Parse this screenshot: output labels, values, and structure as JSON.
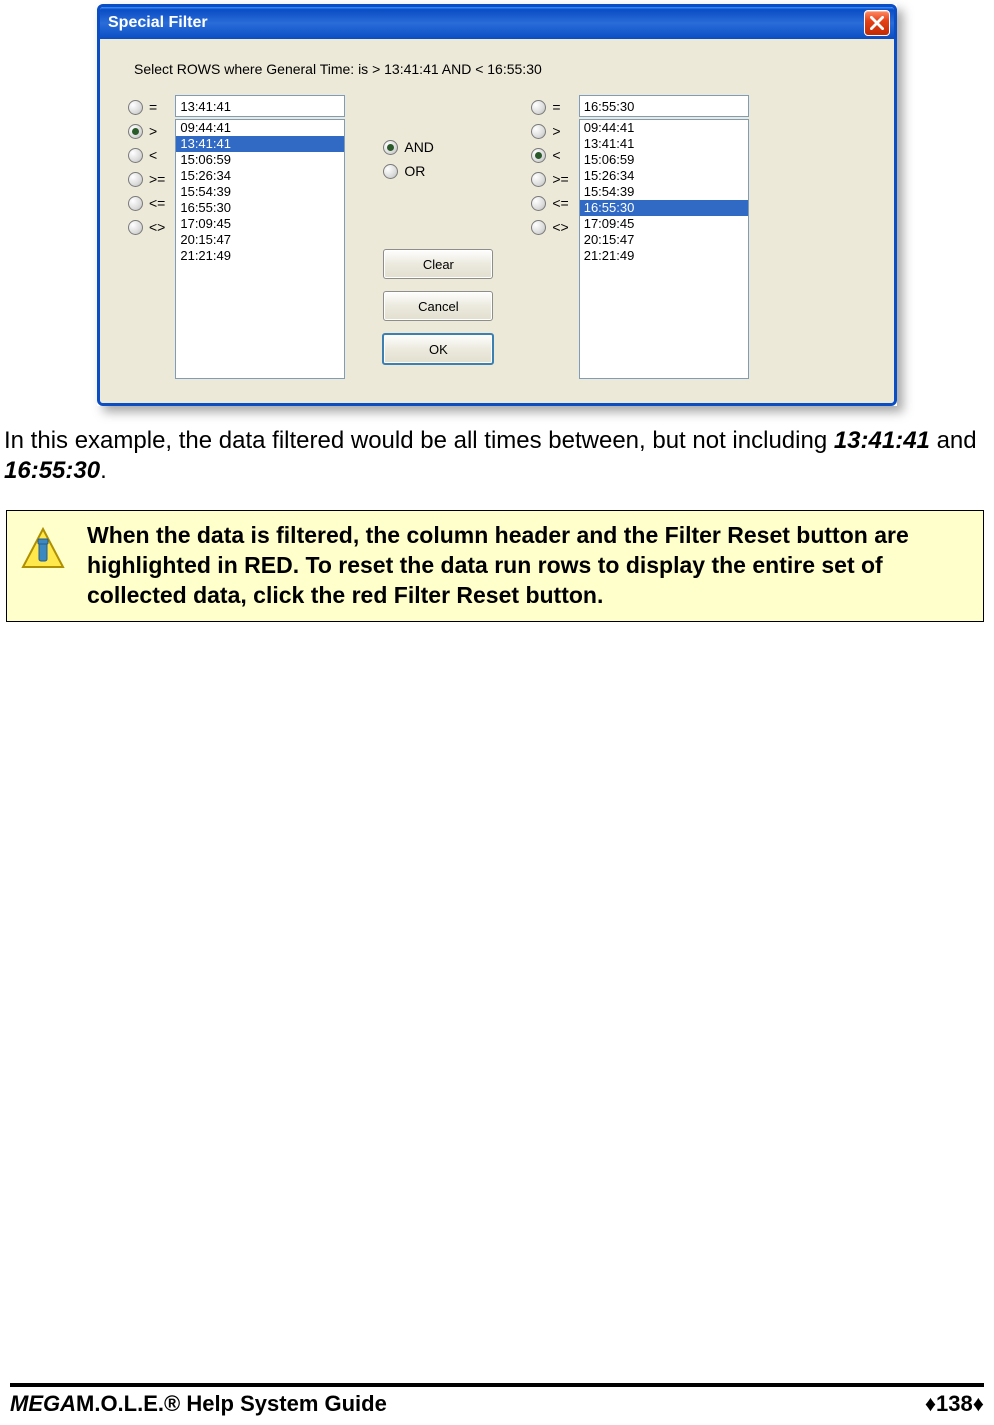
{
  "dialog": {
    "title": "Special Filter",
    "instruction": "Select ROWS where General Time: is > 13:41:41 AND < 16:55:30",
    "operators": [
      "=",
      ">",
      "<",
      ">=",
      "<=",
      "<>"
    ],
    "left": {
      "selected_op_index": 1,
      "value": "13:41:41",
      "list": [
        "09:44:41",
        "13:41:41",
        "15:06:59",
        "15:26:34",
        "15:54:39",
        "16:55:30",
        "17:09:45",
        "20:15:47",
        "21:21:49"
      ],
      "selected_list_index": 1
    },
    "logic": {
      "options": [
        "AND",
        "OR"
      ],
      "selected_index": 0
    },
    "right": {
      "selected_op_index": 2,
      "value": "16:55:30",
      "list": [
        "09:44:41",
        "13:41:41",
        "15:06:59",
        "15:26:34",
        "15:54:39",
        "16:55:30",
        "17:09:45",
        "20:15:47",
        "21:21:49"
      ],
      "selected_list_index": 5
    },
    "buttons": {
      "clear": "Clear",
      "cancel": "Cancel",
      "ok": "OK"
    }
  },
  "body": {
    "para_prefix": "In this example, the data filtered would be all times between, but not including ",
    "time1": "13:41:41",
    "para_mid": " and ",
    "time2": "16:55:30",
    "para_suffix": "."
  },
  "note": "When the data is filtered, the column header and the Filter Reset button are highlighted in RED. To reset the data run rows to display the entire set of collected data, click the red Filter Reset button.",
  "footer": {
    "left_italic": "MEGA",
    "left_rest": "M.O.L.E.® Help System Guide",
    "page": "138"
  }
}
